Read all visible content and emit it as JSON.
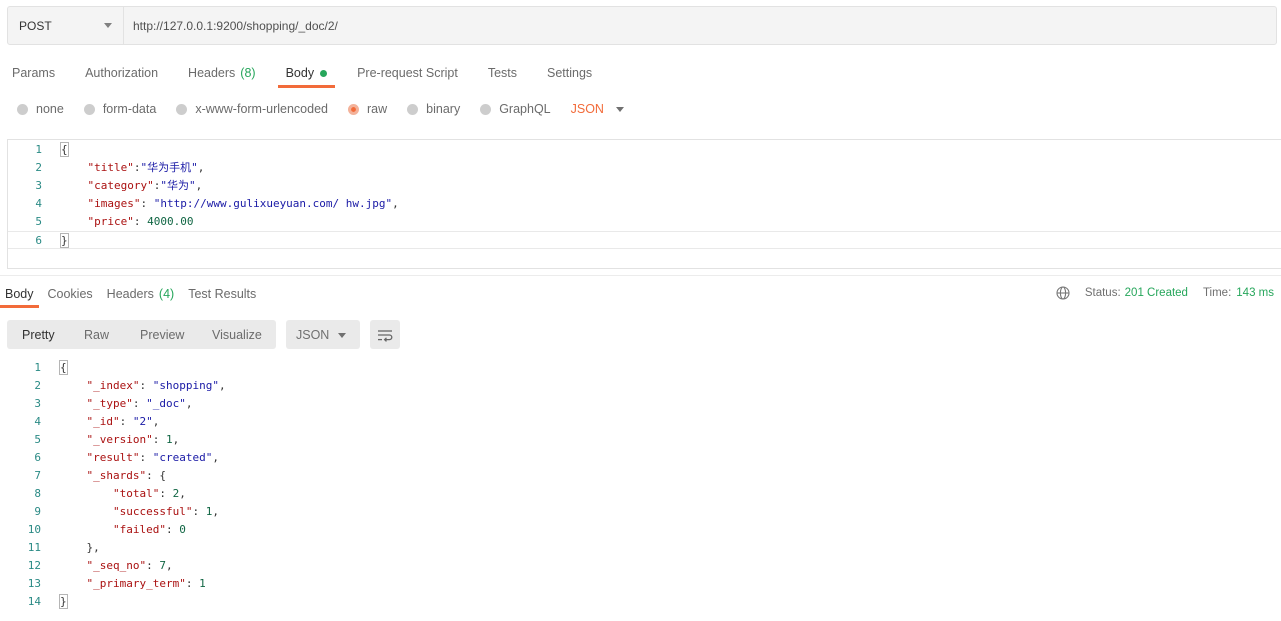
{
  "request": {
    "method": "POST",
    "url": "http://127.0.0.1:9200/shopping/_doc/2/"
  },
  "request_tabs": [
    {
      "label": "Params",
      "count": "",
      "active": false
    },
    {
      "label": "Authorization",
      "count": "",
      "active": false
    },
    {
      "label": "Headers",
      "count": "(8)",
      "active": false
    },
    {
      "label": "Body",
      "count": "",
      "active": true
    },
    {
      "label": "Pre-request Script",
      "count": "",
      "active": false
    },
    {
      "label": "Tests",
      "count": "",
      "active": false
    },
    {
      "label": "Settings",
      "count": "",
      "active": false
    }
  ],
  "body_types": [
    {
      "label": "none",
      "selected": false
    },
    {
      "label": "form-data",
      "selected": false
    },
    {
      "label": "x-www-form-urlencoded",
      "selected": false
    },
    {
      "label": "raw",
      "selected": true
    },
    {
      "label": "binary",
      "selected": false
    },
    {
      "label": "GraphQL",
      "selected": false
    }
  ],
  "body_language": "JSON",
  "request_body_lines": [
    {
      "num": "1",
      "text": "{"
    },
    {
      "num": "2",
      "text": "    \"title\":\"华为手机\","
    },
    {
      "num": "3",
      "text": "    \"category\":\"华为\","
    },
    {
      "num": "4",
      "text": "    \"images\": \"http://www.gulixueyuan.com/ hw.jpg\","
    },
    {
      "num": "5",
      "text": "    \"price\": 4000.00"
    },
    {
      "num": "6",
      "text": "}"
    }
  ],
  "response_tabs": [
    {
      "label": "Body",
      "count": "",
      "active": true
    },
    {
      "label": "Cookies",
      "count": "",
      "active": false
    },
    {
      "label": "Headers",
      "count": "(4)",
      "active": false
    },
    {
      "label": "Test Results",
      "count": "",
      "active": false
    }
  ],
  "status": {
    "status_label": "Status:",
    "status_value": "201 Created",
    "time_label": "Time:",
    "time_value": "143 ms"
  },
  "view_modes": [
    {
      "label": "Pretty",
      "active": true
    },
    {
      "label": "Raw",
      "active": false
    },
    {
      "label": "Preview",
      "active": false
    },
    {
      "label": "Visualize",
      "active": false
    }
  ],
  "response_format": "JSON",
  "response_body_lines": [
    {
      "num": "1",
      "text": "{"
    },
    {
      "num": "2",
      "text": "    \"_index\": \"shopping\","
    },
    {
      "num": "3",
      "text": "    \"_type\": \"_doc\","
    },
    {
      "num": "4",
      "text": "    \"_id\": \"2\","
    },
    {
      "num": "5",
      "text": "    \"_version\": 1,"
    },
    {
      "num": "6",
      "text": "    \"result\": \"created\","
    },
    {
      "num": "7",
      "text": "    \"_shards\": {"
    },
    {
      "num": "8",
      "text": "        \"total\": 2,"
    },
    {
      "num": "9",
      "text": "        \"successful\": 1,"
    },
    {
      "num": "10",
      "text": "        \"failed\": 0"
    },
    {
      "num": "11",
      "text": "    },"
    },
    {
      "num": "12",
      "text": "    \"_seq_no\": 7,"
    },
    {
      "num": "13",
      "text": "    \"_primary_term\": 1"
    },
    {
      "num": "14",
      "text": "}"
    }
  ],
  "colors": {
    "accent": "#f26b3a",
    "success": "#26a65b",
    "key": "#aa1111",
    "string": "#1a1aa6",
    "number": "#116644",
    "line_number": "#2a8a85"
  }
}
